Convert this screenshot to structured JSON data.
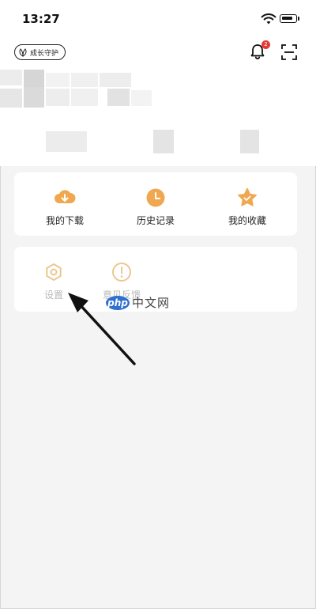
{
  "status_bar": {
    "time": "13:27"
  },
  "header": {
    "guard_badge": "成长守护",
    "notification_count": "2"
  },
  "grid": [
    {
      "label": "我的下载",
      "icon": "download-cloud-icon",
      "color": "#f0a850"
    },
    {
      "label": "历史记录",
      "icon": "clock-icon",
      "color": "#f0a850"
    },
    {
      "label": "我的收藏",
      "icon": "star-icon",
      "color": "#f0a850"
    }
  ],
  "tools": [
    {
      "label": "设置",
      "icon": "gear-icon"
    },
    {
      "label": "意见反馈",
      "icon": "feedback-icon"
    }
  ],
  "watermark": {
    "logo": "php",
    "text": "中文网"
  },
  "colors": {
    "accent": "#f0a850",
    "background": "#f4f4f4",
    "badge": "#e53935"
  }
}
